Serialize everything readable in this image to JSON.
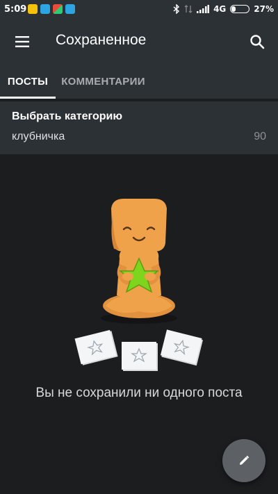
{
  "status_bar": {
    "time": "5:09",
    "network": "4G",
    "battery_percent": "27%",
    "battery_level": 0.27,
    "notification_icons": [
      "messenger-icon",
      "telegram-icon",
      "app-icon",
      "telegram-icon"
    ]
  },
  "app_bar": {
    "title": "Сохраненное",
    "menu_icon": "hamburger-menu-icon",
    "search_icon": "search-icon"
  },
  "tabs": [
    {
      "label": "ПОСТЫ",
      "active": true
    },
    {
      "label": "КОММЕНТАРИИ",
      "active": false
    }
  ],
  "category": {
    "title": "Выбрать категорию",
    "selected": "клубничка",
    "count": "90"
  },
  "empty_state": {
    "message": "Вы не сохранили ни одного поста"
  },
  "fab": {
    "icon": "pencil-icon"
  },
  "colors": {
    "app_bar_bg": "#2c3136",
    "background": "#1c1d1f",
    "fab_bg": "#5d6166",
    "illustration_body": "#f0a24a",
    "illustration_star": "#7fd51d"
  }
}
